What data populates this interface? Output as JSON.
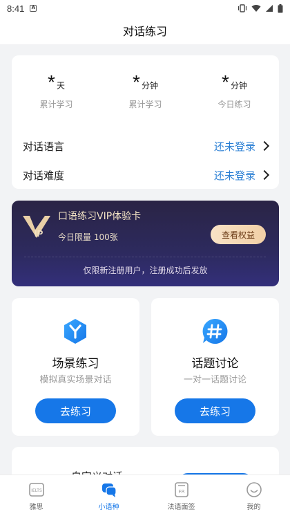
{
  "status_bar": {
    "time": "8:41",
    "notification_icon": "a-badge-icon",
    "icons": [
      "vibrate-icon",
      "wifi-icon",
      "signal-icon",
      "battery-icon"
    ]
  },
  "header": {
    "title": "对话练习"
  },
  "stats": [
    {
      "value": "*",
      "unit": "天",
      "label": "累计学习"
    },
    {
      "value": "*",
      "unit": "分钟",
      "label": "累计学习"
    },
    {
      "value": "*",
      "unit": "分钟",
      "label": "今日练习"
    }
  ],
  "settings": {
    "language": {
      "label": "对话语言",
      "value": "还未登录"
    },
    "difficulty": {
      "label": "对话难度",
      "value": "还未登录"
    }
  },
  "vip": {
    "logo_text": "IP",
    "title": "口语练习VIP体验卡",
    "subtitle": "今日限量 100张",
    "button": "查看权益",
    "note": "仅限新注册用户，注册成功后发放"
  },
  "practice": [
    {
      "icon": "scene-y-icon",
      "title": "场景练习",
      "subtitle": "模拟真实场景对话",
      "button": "去练习"
    },
    {
      "icon": "topic-hash-icon",
      "title": "话题讨论",
      "subtitle": "一对一话题讨论",
      "button": "去练习"
    }
  ],
  "custom": {
    "title": "自定义对话"
  },
  "tabs": [
    {
      "icon": "ielts-icon",
      "label": "雅思",
      "badge": "IELTS"
    },
    {
      "icon": "chat-bubble-icon",
      "label": "小语种"
    },
    {
      "icon": "fr-document-icon",
      "label": "法语面签",
      "badge": "FR"
    },
    {
      "icon": "smiley-icon",
      "label": "我的"
    }
  ],
  "colors": {
    "accent": "#1677e8",
    "link": "#2a7fd4",
    "vip_bg": "#2d2a5e",
    "vip_gold": "#f1cfa6"
  }
}
